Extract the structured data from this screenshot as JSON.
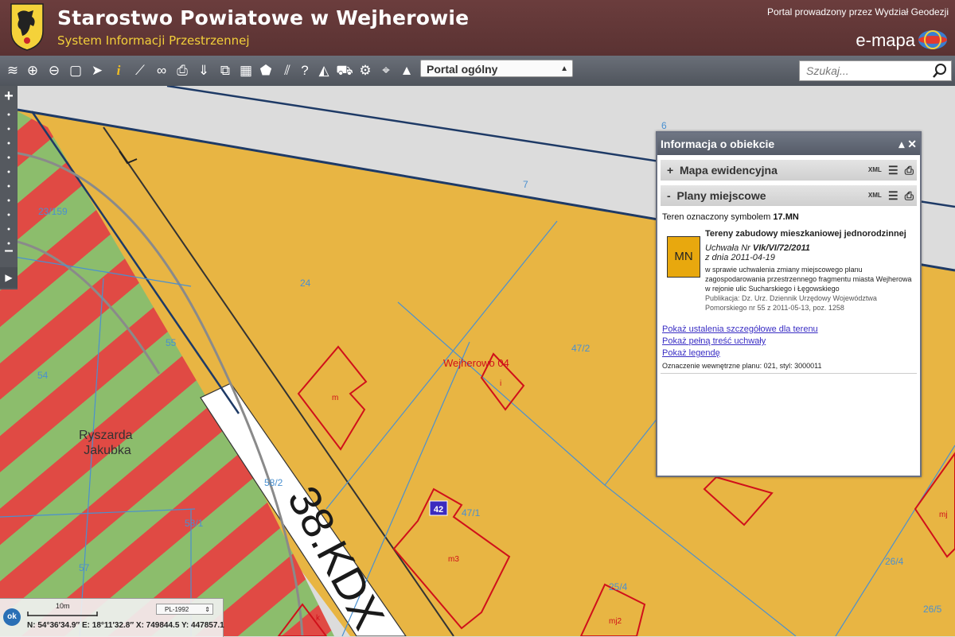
{
  "header": {
    "title": "Starostwo Powiatowe w Wejherowie",
    "subtitle": "System Informacji Przestrzennej",
    "portal_note": "Portal prowadzony przez Wydział Geodezji",
    "brand": "e-mapa"
  },
  "toolbar": {
    "icons": [
      "layers-icon",
      "zoom-in-icon",
      "zoom-out-icon",
      "zoom-extent-icon",
      "pointer-icon",
      "info-icon",
      "measure-icon",
      "link-icon",
      "print-icon",
      "download-icon",
      "export-icon",
      "layout-icon",
      "tag-icon",
      "hatch-icon",
      "help-icon",
      "terrain-icon",
      "cart-icon",
      "settings-icon",
      "location-icon",
      "mountain-icon"
    ],
    "select_value": "Portal ogólny",
    "search_placeholder": "Szukaj..."
  },
  "map": {
    "colors": {
      "residential": "#e8b543",
      "road_gray": "#dcdcdc",
      "stripe_red": "#e04a44",
      "stripe_green": "#8cbd6c",
      "parcel_line": "#4a90d0",
      "building_red": "#d0101a"
    },
    "labels": {
      "p6": "6",
      "p7": "7",
      "p23_159": "23/159",
      "p24": "24",
      "p55": "55",
      "p54": "54",
      "street_name": "Ryszarda\nJakubka",
      "p58_2": "58/2",
      "p58_1": "58/1",
      "p57": "57",
      "p47_2": "47/2",
      "p47_1": "47/1",
      "precinct": "Wejherowo 04",
      "bm": "m",
      "bi": "i",
      "bm3": "m3",
      "bmj2": "mj2",
      "bk": "k",
      "bmj": "mj",
      "p25_4": "25/4",
      "p26_4": "26/4",
      "p26_5": "26/5",
      "road_code": "38.KDX",
      "marker_num": "42"
    }
  },
  "panel": {
    "title": "Informacja o obiekcie",
    "controls": "▴ ✕",
    "section1": {
      "toggle": "+",
      "label": "Mapa ewidencyjna",
      "xml": "XML"
    },
    "section2": {
      "toggle": "-",
      "label": "Plany miejscowe",
      "xml": "XML"
    },
    "terrain_prefix": "Teren oznaczony symbolem ",
    "terrain_symbol": "17.MN",
    "symbol_box": "MN",
    "symbol_color": "#e8a80e",
    "desc_title": "Tereny zabudowy mieszkaniowej jednorodzinnej",
    "resolution_prefix": "Uchwała Nr ",
    "resolution_number": "VIk/VI/72/2011",
    "resolution_date": "z dnia 2011-04-19",
    "resolution_text": "w sprawie uchwalenia zmiany miejscowego planu zagospodarowania przestrzennego fragmentu miasta Wejherowa w rejonie ulic Sucharskiego i Łęgowskiego",
    "publication": "Publikacja: Dz. Urz. Dziennik Urzędowy Województwa Pomorskiego nr 55 z 2011-05-13, poz. 1258",
    "links": [
      "Pokaż ustalenia szczegółowe dla terenu",
      "Pokaż pełną treść uchwały",
      "Pokaż legendę"
    ],
    "internal": "Oznaczenie wewnętrzne planu: 021, styl: 3000011"
  },
  "status": {
    "ok": "ok",
    "scale": "10m",
    "crs": "PL-1992",
    "coords": "N: 54°36′34.9″   E: 18°11′32.8″   X: 749844.5   Y: 447857.1"
  }
}
